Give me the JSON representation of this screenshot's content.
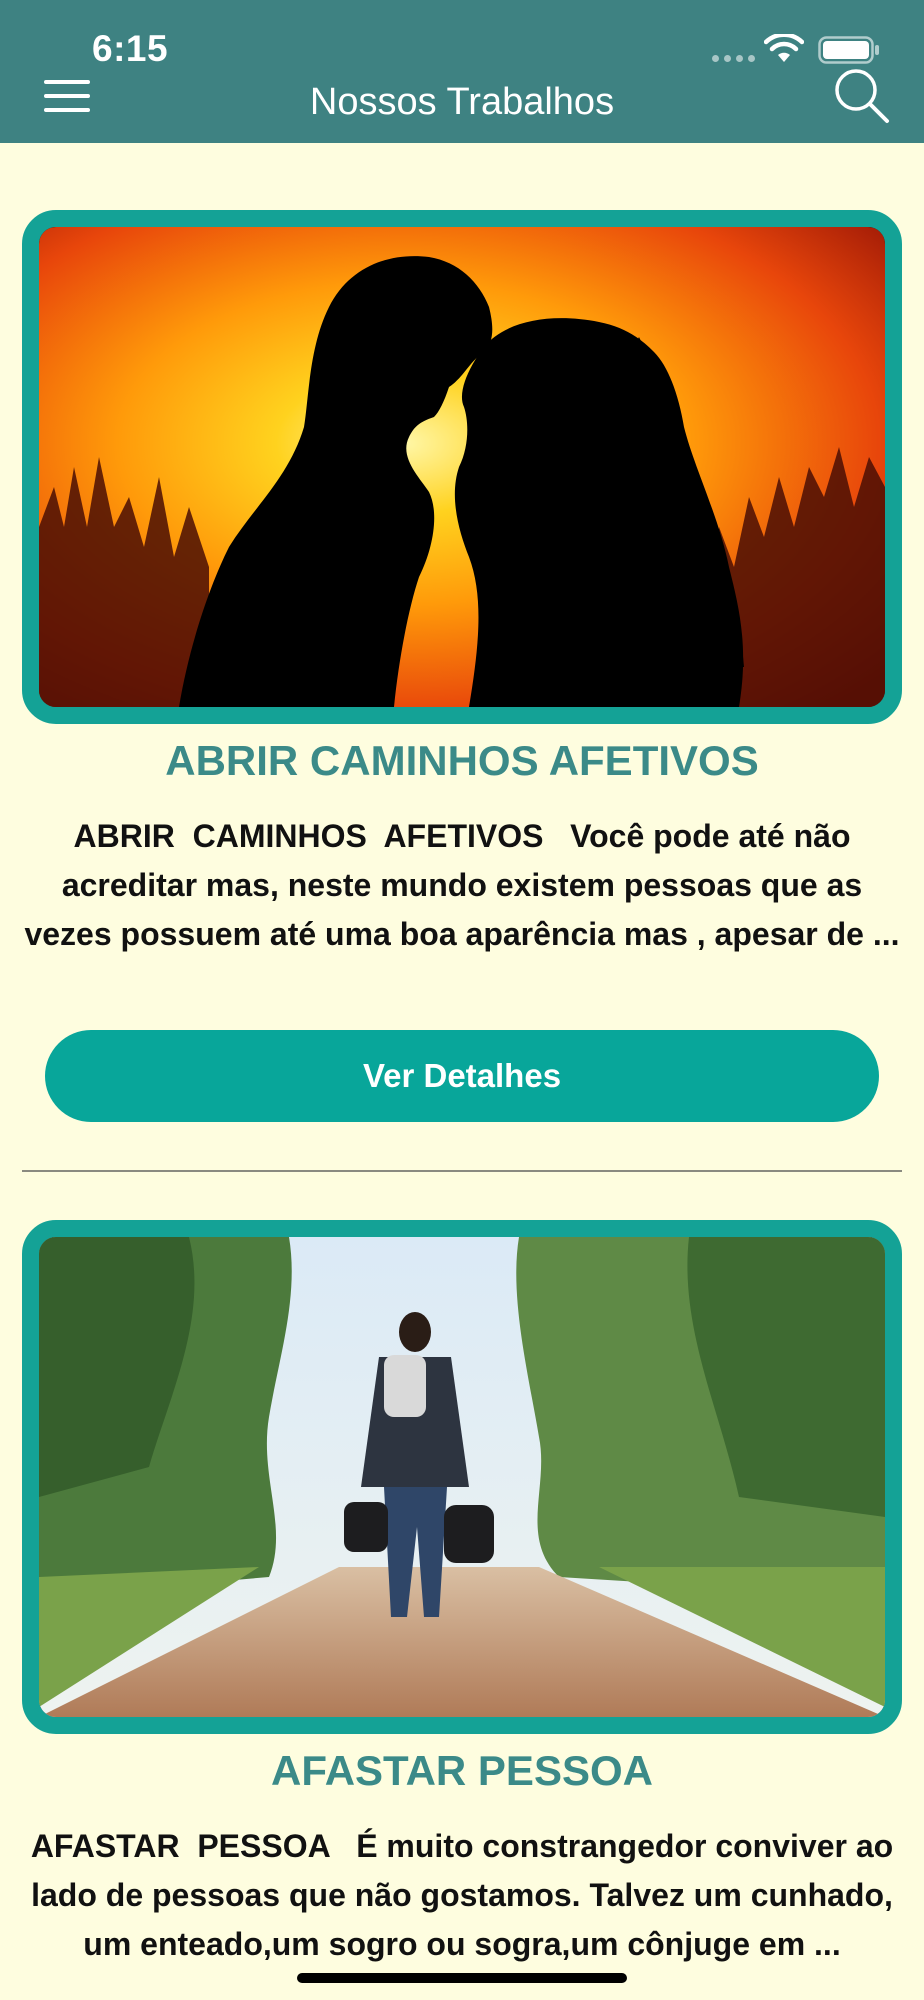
{
  "status_bar": {
    "time": "6:15"
  },
  "header": {
    "title": "Nossos Trabalhos",
    "menu_icon": "hamburger-menu-icon",
    "search_icon": "search-icon"
  },
  "colors": {
    "header_bg": "#3e8282",
    "page_bg": "#fefddf",
    "accent": "#14a296",
    "title_text": "#3b8a88"
  },
  "cards": [
    {
      "title": "ABRIR CAMINHOS AFETIVOS",
      "description": "ABRIR  CAMINHOS  AFETIVOS   Você pode até não acreditar mas, neste mundo existem pessoas que as vezes possuem até uma boa aparência mas , apesar de ...",
      "button_label": "Ver Detalhes",
      "image": "couple-silhouette-sunset"
    },
    {
      "title": "AFASTAR PESSOA",
      "description": "AFASTAR  PESSOA   É muito constrangedor conviver ao lado de pessoas que não gostamos. Talvez um cunhado, um enteado,um sogro ou sogra,um cônjuge em ...",
      "image": "man-walking-dirt-road"
    }
  ]
}
